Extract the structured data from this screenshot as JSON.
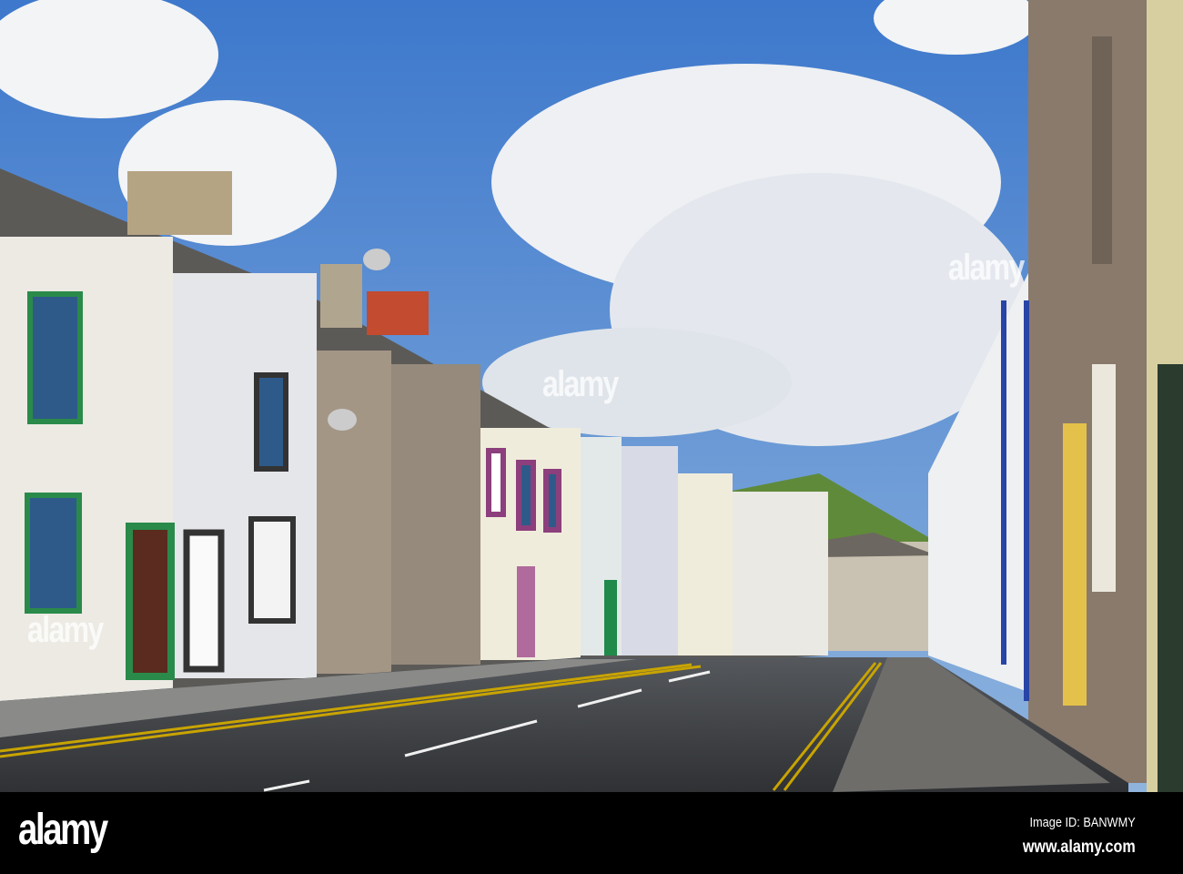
{
  "watermark": {
    "text": "alamy"
  },
  "footer": {
    "logo": "alamy",
    "image_id": "Image ID: BANWMY",
    "website": "www.alamy.com"
  },
  "colors": {
    "sky": "#4f86cf",
    "road": "#3b3d42",
    "footer": "#000000",
    "yellow_line": "#c9a400"
  }
}
